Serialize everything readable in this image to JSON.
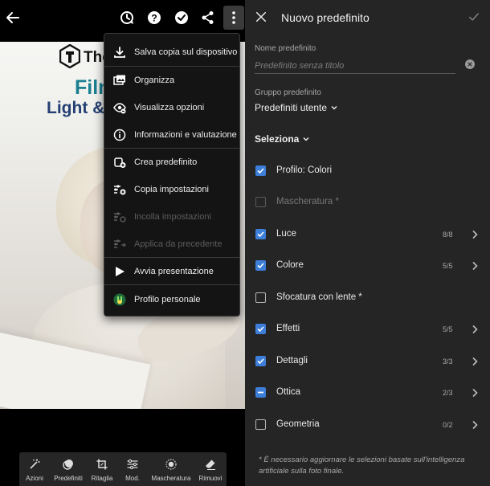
{
  "menu": {
    "items": [
      {
        "label": "Salva copia sul dispositivo",
        "icon": "download-icon",
        "enabled": true
      },
      {
        "label": "Organizza",
        "icon": "organize-icon",
        "enabled": true
      },
      {
        "label": "Visualizza opzioni",
        "icon": "view-options-icon",
        "enabled": true
      },
      {
        "label": "Informazioni e valutazione",
        "icon": "info-icon",
        "enabled": true
      },
      {
        "label": "Crea predefinito",
        "icon": "create-preset-icon",
        "enabled": true
      },
      {
        "label": "Copia impostazioni",
        "icon": "copy-settings-icon",
        "enabled": true
      },
      {
        "label": "Incolla impostazioni",
        "icon": "paste-settings-icon",
        "enabled": false
      },
      {
        "label": "Applica da precedente",
        "icon": "apply-previous-icon",
        "enabled": false
      },
      {
        "label": "Avvia presentazione",
        "icon": "play-icon",
        "enabled": true
      },
      {
        "label": "Profilo personale",
        "icon": "profile-avatar-icon",
        "enabled": true
      }
    ]
  },
  "photo": {
    "brand": "The",
    "title_line1": "Filn",
    "title_line2": "Light &"
  },
  "toolbar": {
    "tools": [
      {
        "label": "Azioni",
        "icon": "magic-wand-icon"
      },
      {
        "label": "Predefiniti",
        "icon": "presets-icon"
      },
      {
        "label": "Ritaglia",
        "icon": "crop-icon"
      },
      {
        "label": "Mod.",
        "icon": "sliders-icon"
      },
      {
        "label": "Mascheratura",
        "icon": "masking-icon"
      },
      {
        "label": "Rimuovi",
        "icon": "eraser-icon"
      }
    ]
  },
  "panel": {
    "title": "Nuovo predefinito",
    "name_label": "Nome predefinito",
    "name_placeholder": "Predefinito senza titolo",
    "name_value": "",
    "group_label": "Gruppo predefinito",
    "group_value": "Predefiniti utente",
    "select_label": "Seleziona",
    "rows": [
      {
        "label": "Profilo: Colori",
        "state": "checked",
        "count": "",
        "chevron": false
      },
      {
        "label": "Mascheratura *",
        "state": "disabled",
        "count": "",
        "chevron": false
      },
      {
        "label": "Luce",
        "state": "checked",
        "count": "8/8",
        "chevron": true
      },
      {
        "label": "Colore",
        "state": "checked",
        "count": "5/5",
        "chevron": true
      },
      {
        "label": "Sfocatura con lente *",
        "state": "unchecked",
        "count": "",
        "chevron": false
      },
      {
        "label": "Effetti",
        "state": "checked",
        "count": "5/5",
        "chevron": true
      },
      {
        "label": "Dettagli",
        "state": "checked",
        "count": "3/3",
        "chevron": true
      },
      {
        "label": "Ottica",
        "state": "partial",
        "count": "2/3",
        "chevron": true
      },
      {
        "label": "Geometria",
        "state": "unchecked",
        "count": "0/2",
        "chevron": true
      }
    ],
    "footnote": "* È necessario aggiornare le selezioni basate sull'intelligenza artificiale sulla foto finale."
  },
  "colors": {
    "accent": "#3d7ed8",
    "panel_bg": "#252525",
    "photo_title_teal": "#1a7f90",
    "photo_title_navy": "#243f73"
  }
}
